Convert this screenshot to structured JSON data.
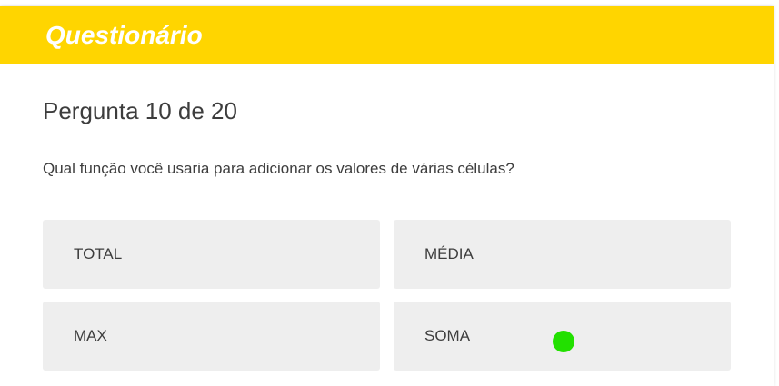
{
  "header": {
    "title": "Questionário",
    "color": "#FFD500"
  },
  "quiz": {
    "counter": "Pergunta 10 de 20",
    "question": "Qual função você usaria para adicionar os valores de várias células?",
    "options": [
      {
        "label": "TOTAL"
      },
      {
        "label": "MÉDIA"
      },
      {
        "label": "MAX"
      },
      {
        "label": "SOMA"
      }
    ]
  },
  "colors": {
    "option_background": "#EEEEEE",
    "text": "#3D3D3D",
    "pointer_marker": "#22E000"
  }
}
